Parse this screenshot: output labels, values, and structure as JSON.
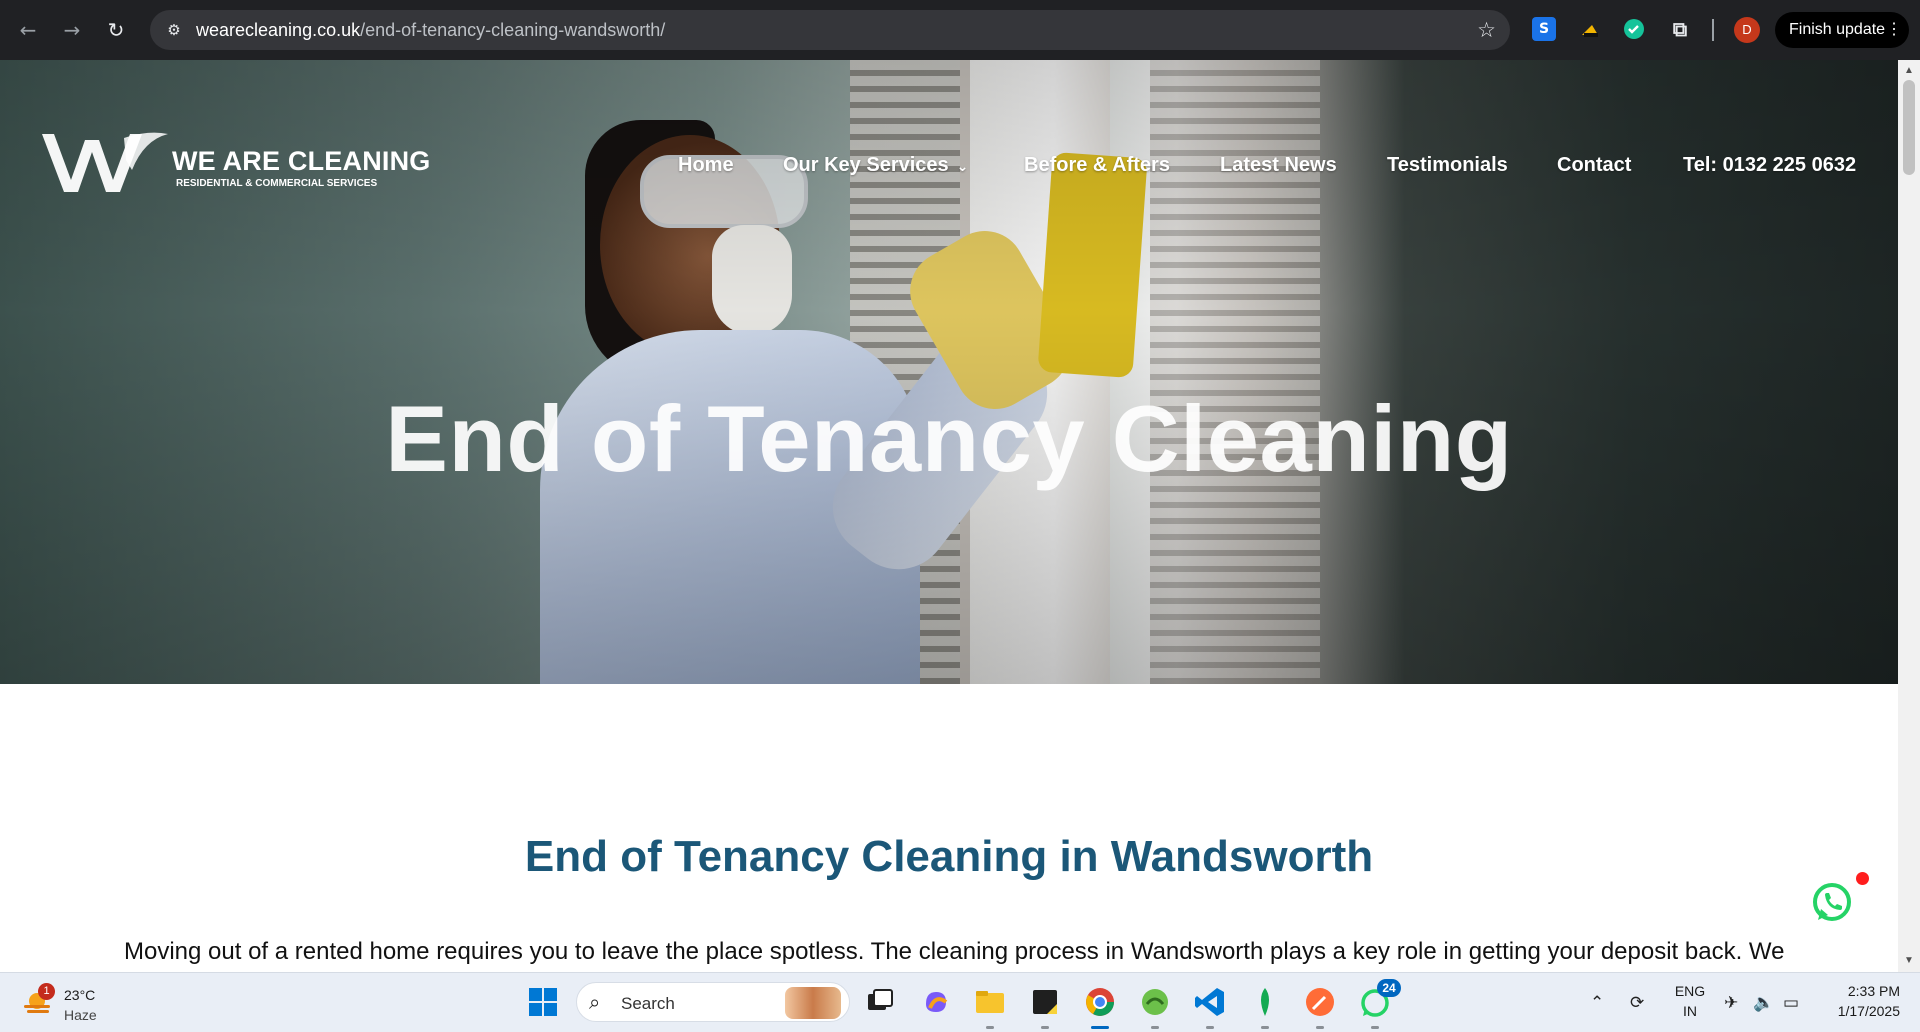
{
  "browser": {
    "url_domain": "wearecleaning.co.uk",
    "url_path": "/end-of-tenancy-cleaning-wandsworth/",
    "profile_initial": "D",
    "finish_update_label": "Finish update"
  },
  "site": {
    "logo_name": "WE ARE CLEANING",
    "logo_tagline": "RESIDENTIAL & COMMERCIAL SERVICES",
    "nav": {
      "home": "Home",
      "services": "Our Key Services",
      "before_afters": "Before & Afters",
      "news": "Latest News",
      "testimonials": "Testimonials",
      "contact": "Contact",
      "phone": "Tel: 0132 225 0632"
    },
    "hero_title": "End of Tenancy Cleaning",
    "section_title": "End of Tenancy Cleaning in Wandsworth",
    "intro_text": "Moving out of a rented home requires you to leave the place spotless. The cleaning process in Wandsworth plays a key role in getting your deposit back. We Are"
  },
  "taskbar": {
    "weather_badge": "1",
    "temperature": "23°C",
    "condition": "Haze",
    "search_label": "Search",
    "whatsapp_badge": "24",
    "lang_top": "ENG",
    "lang_bottom": "IN",
    "time": "2:33 PM",
    "date": "1/17/2025"
  },
  "colors": {
    "heading_blue": "#1b5778",
    "accent_blue": "#0067c0",
    "whatsapp_green": "#25d366"
  }
}
